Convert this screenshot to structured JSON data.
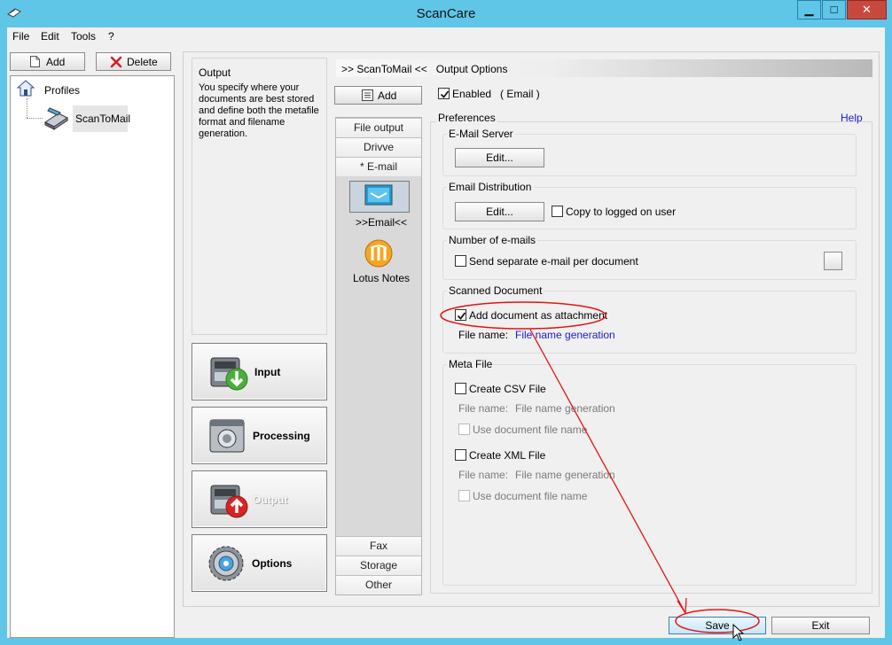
{
  "window": {
    "title": "ScanCare",
    "min_label": "▁",
    "max_label": "□",
    "close_label": "✕"
  },
  "menu": {
    "file": "File",
    "edit": "Edit",
    "tools": "Tools",
    "help": "?"
  },
  "left": {
    "add_label": "Add",
    "delete_label": "Delete",
    "tree_root": "Profiles",
    "tree_child": "ScanToMail"
  },
  "info": {
    "heading": "Output",
    "description": "You specify where your documents are best stored and define both the metafile format and filename generation."
  },
  "nav": {
    "input": "Input",
    "processing": "Processing",
    "output": "Output",
    "options": "Options"
  },
  "header": {
    "crumb": ">> ScanToMail <<   Output Options"
  },
  "mid": {
    "add_label": "Add",
    "tabs_top": [
      "File output",
      "Drivve",
      "* E-mail"
    ],
    "email_item": ">>Email<<",
    "lotus_item": "Lotus Notes",
    "tabs_bottom": [
      "Fax",
      "Storage",
      "Other"
    ]
  },
  "right": {
    "enabled_label": "Enabled   ( Email )",
    "preferences": "Preferences",
    "help": "Help",
    "email_server": {
      "title": "E-Mail Server",
      "edit": "Edit..."
    },
    "distribution": {
      "title": "Email Distribution",
      "edit": "Edit...",
      "copy_label": "Copy to logged on user"
    },
    "num_emails": {
      "title": "Number of e-mails",
      "separate_label": "Send separate e-mail per document"
    },
    "scanned": {
      "title": "Scanned Document",
      "attach_label": "Add document as attachment",
      "filename_label": "File name:",
      "filename_link": "File name generation"
    },
    "meta": {
      "title": "Meta File",
      "csv_label": "Create CSV File",
      "csv_filename_label": "File name:",
      "csv_filename_value": "File name generation",
      "csv_use_doc": "Use document file name",
      "xml_label": "Create XML File",
      "xml_filename_label": "File name:",
      "xml_filename_value": "File name generation",
      "xml_use_doc": "Use document file name"
    }
  },
  "footer": {
    "save": "Save",
    "exit": "Exit"
  },
  "colors": {
    "titlebar": "#5fc6e8",
    "close": "#c9483e",
    "annotation": "#e21414",
    "link": "#1a1ad6"
  }
}
